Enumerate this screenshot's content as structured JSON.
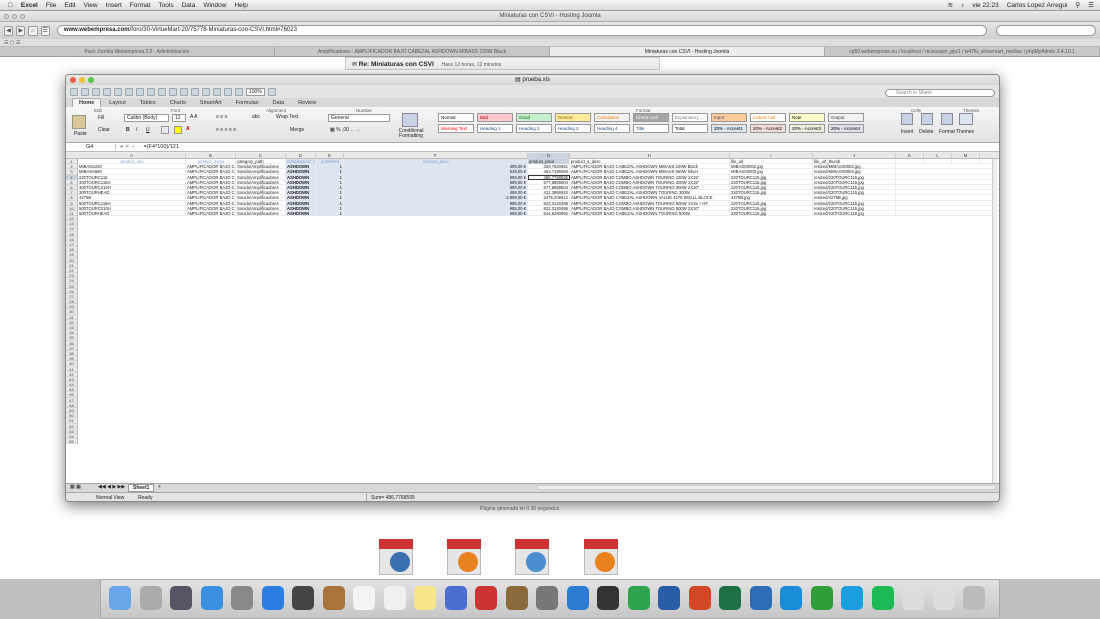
{
  "menubar": {
    "app": "Excel",
    "items": [
      "File",
      "Edit",
      "View",
      "Insert",
      "Format",
      "Tools",
      "Data",
      "Window",
      "Help"
    ],
    "clock": "vie 22:23",
    "user": "Carlos Lopez Arregui"
  },
  "browser": {
    "window_title": "Miniaturas con CSVI - Hosting Joomla",
    "url_prefix": "www.webempresa.com",
    "url_rest": "/foro/30-VirtueMart-20/75778-Miniaturas-con-CSVI.html#76023",
    "tabs": [
      "Pack Joomla Webempresa 2.5 - Administración",
      "Amplificadores : AMPLIFICADOR BAJO CABEZAL ASHDOWN MIBASS 220W Black",
      "Miniaturas con CSVI - Hosting Joomla",
      "cp50.webempresa.eu / localhost / musicaym_pjw1 / w47fu_virtuemart_medias | phpMyAdmin 3.4.10.1"
    ],
    "active_tab": 2
  },
  "post": {
    "title": "Re: Miniaturas con CSVI",
    "meta": "Hace 12 horas, 12 minutos"
  },
  "footer": "Página generada en 0.36 segundos",
  "excel": {
    "title": "prueba.xls",
    "zoom": "100%",
    "search_placeholder": "Search in Sheet",
    "ribbon_tabs": [
      "Home",
      "Layout",
      "Tables",
      "Charts",
      "SmartArt",
      "Formulas",
      "Data",
      "Review"
    ],
    "active_ribbon_tab": "Home",
    "groups": {
      "edit": "Edit",
      "font": "Font",
      "alignment": "Alignment",
      "number": "Number",
      "format": "Format",
      "cells": "Cells",
      "themes": "Themes"
    },
    "fill_label": "Fill",
    "clear_label": "Clear",
    "paste_label": "Paste",
    "font_name": "Calibri (Body)",
    "font_size": "12",
    "wrap_label": "Wrap Text",
    "merge_label": "Merge",
    "number_format": "General",
    "cond_label": "Conditional Formatting",
    "styles": [
      {
        "name": "Normal",
        "bg": "#ffffff",
        "fg": "#000"
      },
      {
        "name": "Bad",
        "bg": "#ffc7ce",
        "fg": "#9c0006"
      },
      {
        "name": "Good",
        "bg": "#c6efce",
        "fg": "#006100"
      },
      {
        "name": "Neutral",
        "bg": "#ffeb9c",
        "fg": "#9c6500"
      },
      {
        "name": "Calculation",
        "bg": "#f2f2f2",
        "fg": "#fa7d00"
      },
      {
        "name": "Check Cell",
        "bg": "#a5a5a5",
        "fg": "#ffffff"
      },
      {
        "name": "Explanatory ...",
        "bg": "#ffffff",
        "fg": "#7f7f7f"
      },
      {
        "name": "Input",
        "bg": "#ffcc99",
        "fg": "#3f3f76"
      },
      {
        "name": "Linked Cell",
        "bg": "#ffffff",
        "fg": "#fa7d00"
      },
      {
        "name": "Note",
        "bg": "#ffffcc",
        "fg": "#000"
      },
      {
        "name": "Output",
        "bg": "#f2f2f2",
        "fg": "#3f3f3f"
      },
      {
        "name": "Warning Text",
        "bg": "#ffffff",
        "fg": "#ff0000"
      },
      {
        "name": "Heading 1",
        "bg": "#ffffff",
        "fg": "#1f497d"
      },
      {
        "name": "Heading 2",
        "bg": "#ffffff",
        "fg": "#1f497d"
      },
      {
        "name": "Heading 3",
        "bg": "#ffffff",
        "fg": "#1f497d"
      },
      {
        "name": "Heading 4",
        "bg": "#ffffff",
        "fg": "#1f497d"
      },
      {
        "name": "Title",
        "bg": "#ffffff",
        "fg": "#1f497d"
      },
      {
        "name": "Total",
        "bg": "#ffffff",
        "fg": "#000"
      },
      {
        "name": "20% - Accent1",
        "bg": "#dce6f1",
        "fg": "#000"
      },
      {
        "name": "20% - Accent2",
        "bg": "#f2dcdb",
        "fg": "#000"
      },
      {
        "name": "20% - Accent3",
        "bg": "#ebf1de",
        "fg": "#000"
      },
      {
        "name": "20% - Accent4",
        "bg": "#e4dfec",
        "fg": "#000"
      }
    ],
    "cell_buttons": [
      "Insert",
      "Delete",
      "Format"
    ],
    "themes_label": "Themes",
    "namebox": "G4",
    "formula": "=(F4*100)/121",
    "columns": [
      "A",
      "B",
      "C",
      "D",
      "E",
      "F",
      "G",
      "H",
      "I",
      "J",
      "K",
      "L",
      "M"
    ],
    "headers": [
      "product_sku",
      "product_name",
      "category_path",
      "manufacturer_name",
      "published",
      "product_price",
      "product_price",
      "product_s_desc",
      "file_url",
      "file_url_thumb",
      "",
      "",
      ""
    ],
    "rows": [
      [
        "MIBASS220",
        "AMPLIFICADOR BAJO CABEZAL",
        "Sonido/Amplificadores",
        "ASHDOWN",
        "1",
        "399,00 €",
        "329,7520661",
        "AMPLIFICADOR BAJO CABEZAL ASHDOWN MIBASS 220W Black",
        "MIBASS0002.jpg",
        "resized/MIBASS0002.jpg"
      ],
      [
        "MIBASS550",
        "AMPLIFICADOR BAJO CABEZAL",
        "Sonido/Amplificadores",
        "ASHDOWN",
        "1",
        "549,00 €",
        "453,7190083",
        "AMPLIFICADOR BAJO CABEZAL ASHDOWN MIBASS 550W Silver",
        "MIBASS0003.jpg",
        "resized/MIBASS0003.jpg"
      ],
      [
        "220TOURC115",
        "AMPLIFICADOR BAJO COMBO",
        "Sonido/Amplificadores",
        "ASHDOWN",
        "1",
        "589,00 €",
        "486,7768595",
        "AMPLIFICADOR BAJO COMBO ASHDOWN TOURING 220W 1X15\"",
        "220TOURC115.jpg",
        "resized/220TOURC115.jpg"
      ],
      [
        "300TOURC115H",
        "AMPLIFICADOR BAJO COMBO",
        "Sonido/Amplificadores",
        "ASHDOWN",
        "1",
        "699,00 €",
        "577,6859504",
        "AMPLIFICADOR BAJO COMBO ASHDOWN TOURING 300W 1X15\"",
        "220TOURC115.jpg",
        "resized/220TOURC115.jpg"
      ],
      [
        "300TOURC210H",
        "AMPLIFICADOR BAJO COMBO",
        "Sonido/Amplificadores",
        "ASHDOWN",
        "1",
        "699,00 €",
        "577,6859504",
        "AMPLIFICADOR BAJO COMBO ASHDOWN TOURING 300W 2X10\"",
        "220TOURC115.jpg",
        "resized/220TOURC115.jpg"
      ],
      [
        "300TOURHEAD",
        "AMPLIFICADOR BAJO CABEZAL",
        "Sonido/Amplificadores",
        "ASHDOWN",
        "1",
        "499,00 €",
        "412,3966942",
        "AMPLIFICADOR BAJO CABEZAL ASHDOWN TOURING 300W",
        "220TOURC115.jpg",
        "resized/220TOURC115.jpg"
      ],
      [
        "4275B",
        "AMPLIFICADOR BAJO CABEZAL",
        "Sonido/Amplificadores",
        "ASHDOWN",
        "1",
        "2.999,00 €",
        "2475,206612",
        "AMPLIFICADOR BAJO CABEZAL ASHDOWN VALUE 4275 SMALL BLOCK",
        "4275B.jpg",
        "resized/4275B.jpg"
      ],
      [
        "500TOURC115H",
        "AMPLIFICADOR BAJO COMBO",
        "Sonido/Amplificadores",
        "ASHDOWN",
        "1",
        "995,00 €",
        "822,3140496",
        "AMPLIFICADOR BAJO COMBO ASHDOWN TOURING 500W 1X15 + HF",
        "220TOURC115.jpg",
        "resized/220TOURC115.jpg"
      ],
      [
        "500TOURC210H",
        "AMPLIFICADOR BAJO COMBO",
        "Sonido/Amplificadores",
        "ASHDOWN",
        "1",
        "995,00 €",
        "822,3140496",
        "AMPLIFICADOR BAJO COMBO ASHDOWN TOURING 500W 2X10\"",
        "220TOURC115.jpg",
        "resized/220TOURC115.jpg"
      ],
      [
        "500TOURHEAD",
        "AMPLIFICADOR BAJO CABEZAL",
        "Sonido/Amplificadores",
        "ASHDOWN",
        "1",
        "659,00 €",
        "544,6280992",
        "AMPLIFICADOR BAJO CABEZAL ASHDOWN TOURING 500W",
        "220TOURC115.jpg",
        "resized/220TOURC115.jpg"
      ]
    ],
    "row_count": 55,
    "sheet_name": "Sheet1",
    "status_view": "Normal View",
    "status_ready": "Ready",
    "status_sum": "Sum= 486,7768595"
  },
  "dock_icons": [
    "finder-icon",
    "launchpad-icon",
    "mission-control-icon",
    "app-store-icon",
    "system-prefs-icon",
    "safari-icon",
    "photobooth-icon",
    "contacts-icon",
    "calendar-icon",
    "reminders-icon",
    "notes-icon",
    "itunes-icon",
    "photo-booth-icon",
    "iphoto-icon",
    "preferences-icon",
    "transmission-icon",
    "camera-icon",
    "utorrent-icon",
    "word-icon",
    "powerpoint-icon",
    "excel-icon",
    "outlook-icon",
    "communicator-icon",
    "messenger-icon",
    "skype-icon",
    "spotify-icon",
    "downloads-icon",
    "documents-icon",
    "trash-icon"
  ]
}
